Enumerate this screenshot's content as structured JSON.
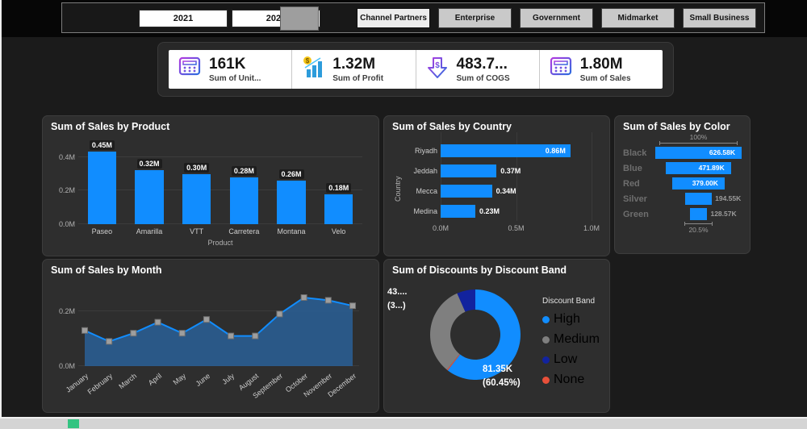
{
  "colors": {
    "accent": "#118DFF",
    "area_fill": "#2A5F94",
    "marker": "#9E9E9E",
    "slice_high": "#118DFF",
    "slice_medium": "#7F7F7F",
    "slice_low": "#12239E",
    "slice_none": "#E8503A"
  },
  "slicers": {
    "years": [
      "2021",
      "2022"
    ],
    "segments": [
      {
        "label": "Channel Partners",
        "selected": true
      },
      {
        "label": "Enterprise",
        "selected": false
      },
      {
        "label": "Government",
        "selected": false
      },
      {
        "label": "Midmarket",
        "selected": false
      },
      {
        "label": "Small Business",
        "selected": false
      }
    ]
  },
  "kpis": [
    {
      "value": "161K",
      "label": "Sum of Unit...",
      "icon": "calculator-icon"
    },
    {
      "value": "1.32M",
      "label": "Sum of Profit",
      "icon": "profit-chart-icon"
    },
    {
      "value": "483.7...",
      "label": "Sum of COGS",
      "icon": "dollar-down-arrow-icon"
    },
    {
      "value": "1.80M",
      "label": "Sum of Sales",
      "icon": "calculator-icon"
    }
  ],
  "chart_data": [
    {
      "type": "bar",
      "title": "Sum of Sales by Product",
      "categories": [
        "Paseo",
        "Amarilla",
        "VTT",
        "Carretera",
        "Montana",
        "Velo"
      ],
      "values": [
        0.45,
        0.32,
        0.3,
        0.28,
        0.26,
        0.18
      ],
      "labels": [
        "0.45M",
        "0.32M",
        "0.30M",
        "0.28M",
        "0.26M",
        "0.18M"
      ],
      "xlabel": "Product",
      "yticks": [
        "0.0M",
        "0.2M",
        "0.4M"
      ],
      "ytick_values": [
        0,
        0.2,
        0.4
      ],
      "ylim": 0.5
    },
    {
      "type": "bar-horizontal",
      "title": "Sum of Sales by Country",
      "categories": [
        "Riyadh",
        "Jeddah",
        "Mecca",
        "Medina"
      ],
      "values": [
        0.86,
        0.37,
        0.34,
        0.23
      ],
      "labels": [
        "0.86M",
        "0.37M",
        "0.34M",
        "0.23M"
      ],
      "ylabel": "Country",
      "xticks": [
        "0.0M",
        "0.5M",
        "1.0M"
      ],
      "xtick_values": [
        0,
        0.5,
        1.0
      ],
      "xlim": 1.0
    },
    {
      "type": "funnel",
      "title": "Sum of Sales by Color",
      "categories": [
        "Black",
        "Blue",
        "Red",
        "Silver",
        "Green"
      ],
      "values": [
        626.58,
        471.89,
        379.0,
        194.55,
        128.57
      ],
      "labels": [
        "626.58K",
        "471.89K",
        "379.00K",
        "194.55K",
        "128.57K"
      ],
      "top_label": "100%",
      "bottom_label": "20.5%"
    },
    {
      "type": "area",
      "title": "Sum of Sales by Month",
      "categories": [
        "January",
        "February",
        "March",
        "April",
        "May",
        "June",
        "July",
        "August",
        "September",
        "October",
        "November",
        "December"
      ],
      "values": [
        0.13,
        0.09,
        0.12,
        0.16,
        0.12,
        0.17,
        0.11,
        0.11,
        0.19,
        0.25,
        0.24,
        0.22
      ],
      "yticks": [
        "0.0M",
        "0.2M"
      ],
      "ytick_values": [
        0,
        0.2
      ],
      "ylim": 0.3
    },
    {
      "type": "donut",
      "title": "Sum of Discounts by Discount Band",
      "legend_title": "Discount Band",
      "slices": [
        {
          "name": "High",
          "percent": 60.45,
          "color": "#118DFF"
        },
        {
          "name": "None",
          "percent": 0.4,
          "color": "#E8503A"
        },
        {
          "name": "Medium",
          "percent": 32.55,
          "color": "#7F7F7F"
        },
        {
          "name": "Low",
          "percent": 6.6,
          "color": "#12239E"
        }
      ],
      "legend_order": [
        "High",
        "Medium",
        "Low",
        "None"
      ],
      "callout_medium": [
        "43....",
        "(3...)"
      ],
      "callout_high": [
        "81.35K",
        "(60.45%)"
      ]
    }
  ]
}
